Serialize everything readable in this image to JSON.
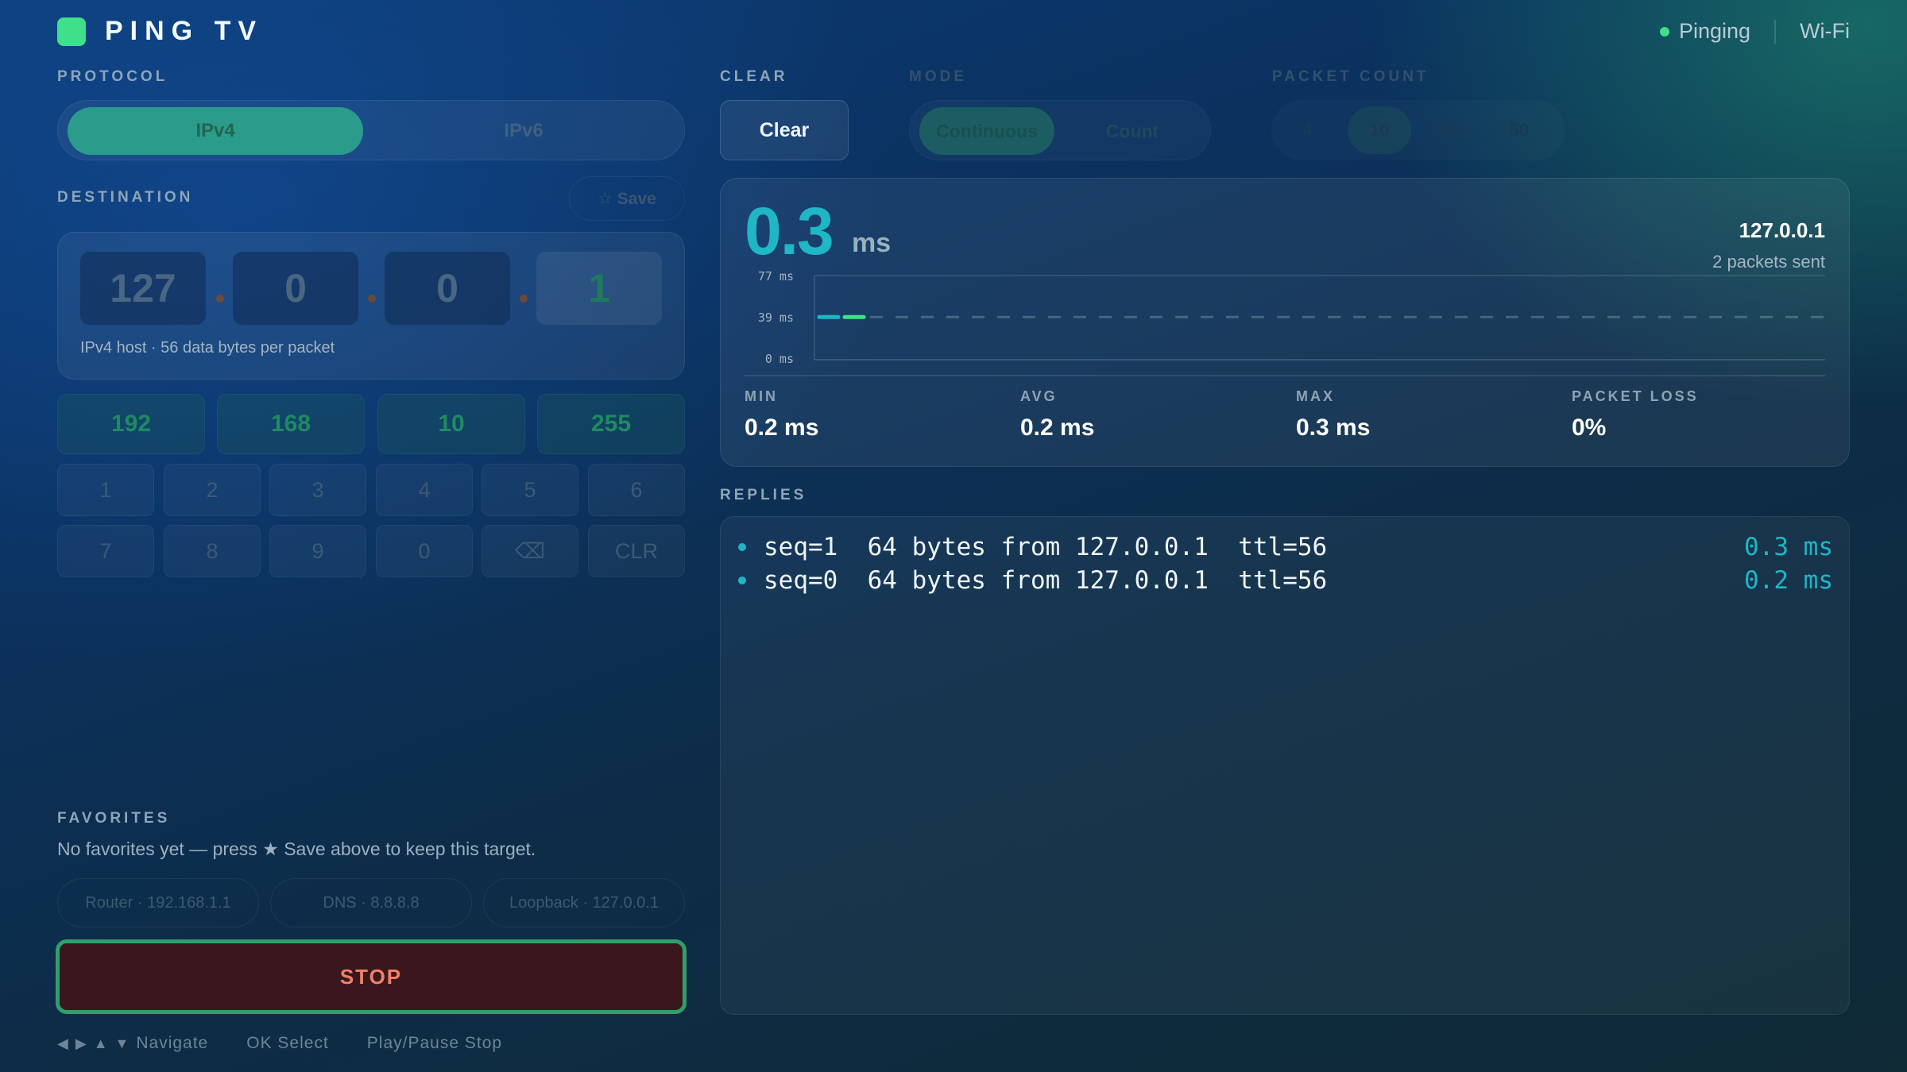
{
  "header": {
    "app_title": "PING TV",
    "status": "Pinging",
    "network": "Wi-Fi",
    "status_color": "#3fe08a"
  },
  "protocol": {
    "label": "PROTOCOL",
    "options": [
      "IPv4",
      "IPv6"
    ],
    "selected": "IPv4"
  },
  "destination": {
    "label": "DESTINATION",
    "save_label": "☆ Save",
    "octets": [
      "127",
      "0",
      "0",
      "1"
    ],
    "hint": "IPv4 host · 56 data bytes per packet"
  },
  "presets": [
    "192",
    "168",
    "10",
    "255"
  ],
  "keypad": [
    "1",
    "2",
    "3",
    "4",
    "5",
    "6",
    "7",
    "8",
    "9",
    "0",
    "⌫",
    "CLR"
  ],
  "favorites": {
    "label": "FAVORITES",
    "empty_text": "No favorites yet — press ★ Save above to keep this target.",
    "chips": [
      "Router · 192.168.1.1",
      "DNS · 8.8.8.8",
      "Loopback · 127.0.0.1"
    ]
  },
  "stop_label": "STOP",
  "hints": {
    "navigate": "Navigate",
    "select": "OK Select",
    "stop": "Play/Pause Stop"
  },
  "controls": {
    "clear_label": "CLEAR",
    "clear_button": "Clear",
    "mode_label": "MODE",
    "mode_options": [
      "Continuous",
      "Count"
    ],
    "mode_selected": "Continuous",
    "count_label": "PACKET COUNT",
    "count_options": [
      "4",
      "10",
      "25",
      "50"
    ],
    "count_selected": "10"
  },
  "stats": {
    "latency": "0.3",
    "latency_unit": "ms",
    "target": "127.0.0.1",
    "packets_sent": "2 packets sent",
    "min_label": "MIN",
    "min": "0.2 ms",
    "avg_label": "AVG",
    "avg": "0.2 ms",
    "max_label": "MAX",
    "max": "0.3 ms",
    "loss_label": "PACKET LOSS",
    "loss": "0%"
  },
  "chart_data": {
    "type": "line",
    "title": "",
    "xlabel": "",
    "ylabel": "",
    "y_ticks": [
      "77 ms",
      "39 ms",
      "0 ms"
    ],
    "ylim": [
      0,
      77
    ],
    "series": [
      {
        "values": [
          0.2,
          0.3
        ]
      }
    ],
    "baseline_ms": 39,
    "colors": [
      "#20b4c4",
      "#3fe08a"
    ]
  },
  "replies": {
    "label": "REPLIES",
    "rows": [
      {
        "text": "seq=1  64 bytes from 127.0.0.1  ttl=56",
        "time": "0.3 ms"
      },
      {
        "text": "seq=0  64 bytes from 127.0.0.1  ttl=56",
        "time": "0.2 ms"
      }
    ]
  }
}
